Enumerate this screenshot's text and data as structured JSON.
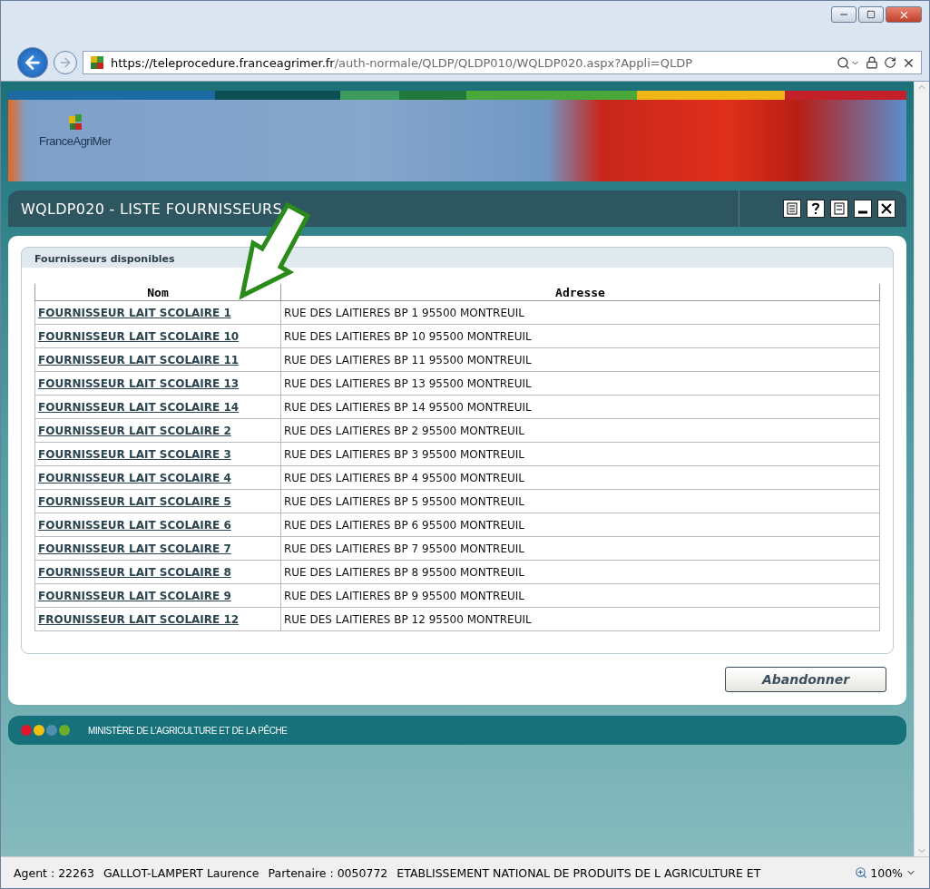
{
  "browser": {
    "url_host": "https://teleprocedure.franceagrimer.fr",
    "url_path": "/auth-normale/QLDP/QLDP010/WQLDP020.aspx?Appli=QLDP"
  },
  "banner": {
    "logo_text": "FranceAgriMer"
  },
  "page_title": "WQLDP020 - LISTE FOURNISSEURS",
  "panel": {
    "title": "Fournisseurs disponibles",
    "table": {
      "columns": [
        "Nom",
        "Adresse"
      ],
      "rows": [
        {
          "name": "FOURNISSEUR LAIT SCOLAIRE 1",
          "address": "RUE DES LAITIERES BP 1 95500 MONTREUIL"
        },
        {
          "name": "FOURNISSEUR LAIT SCOLAIRE 10",
          "address": "RUE DES LAITIERES BP 10 95500 MONTREUIL"
        },
        {
          "name": "FOURNISSEUR LAIT SCOLAIRE 11",
          "address": "RUE DES LAITIERES BP 11 95500 MONTREUIL"
        },
        {
          "name": "FOURNISSEUR LAIT SCOLAIRE 13",
          "address": "RUE DES LAITIERES BP 13 95500 MONTREUIL"
        },
        {
          "name": "FOURNISSEUR LAIT SCOLAIRE 14",
          "address": "RUE DES LAITIERES BP 14 95500 MONTREUIL"
        },
        {
          "name": "FOURNISSEUR LAIT SCOLAIRE 2",
          "address": "RUE DES LAITIERES BP 2 95500 MONTREUIL"
        },
        {
          "name": "FOURNISSEUR LAIT SCOLAIRE 3",
          "address": "RUE DES LAITIERES BP 3 95500 MONTREUIL"
        },
        {
          "name": "FOURNISSEUR LAIT SCOLAIRE 4",
          "address": "RUE DES LAITIERES BP 4 95500 MONTREUIL"
        },
        {
          "name": "FOURNISSEUR LAIT SCOLAIRE 5",
          "address": "RUE DES LAITIERES BP 5 95500 MONTREUIL"
        },
        {
          "name": "FOURNISSEUR LAIT SCOLAIRE 6",
          "address": "RUE DES LAITIERES BP 6 95500 MONTREUIL"
        },
        {
          "name": "FOURNISSEUR LAIT SCOLAIRE 7",
          "address": "RUE DES LAITIERES BP 7 95500 MONTREUIL"
        },
        {
          "name": "FOURNISSEUR LAIT SCOLAIRE 8",
          "address": "RUE DES LAITIERES BP 8 95500 MONTREUIL"
        },
        {
          "name": "FOURNISSEUR LAIT SCOLAIRE 9",
          "address": "RUE DES LAITIERES BP 9 95500 MONTREUIL"
        },
        {
          "name": "FROUNISSEUR LAIT SCOLAIRE 12",
          "address": "RUE DES LAITIERES BP 12 95500 MONTREUIL"
        }
      ]
    }
  },
  "buttons": [
    "Abandonner"
  ],
  "footer": {
    "dots": [
      {
        "color": "#e0142c"
      },
      {
        "color": "#f0c010"
      },
      {
        "color": "#4f8fb0"
      },
      {
        "color": "#6cb02a"
      }
    ],
    "text": "MINISTÈRE DE L'AGRICULTURE ET DE LA PÊCHE"
  },
  "status_bar": {
    "agent": "Agent : 22263",
    "name": "GALLOT-LAMPERT Laurence",
    "partner": "Partenaire : 0050772",
    "organisation": "ETABLISSEMENT NATIONAL DE PRODUITS DE L AGRICULTURE ET",
    "zoom": "100%"
  }
}
